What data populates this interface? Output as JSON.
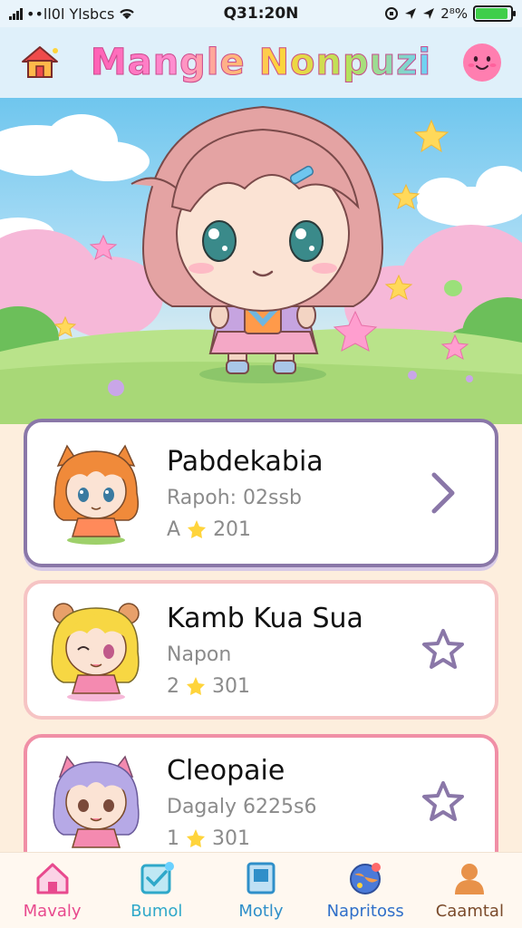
{
  "status_bar": {
    "carrier": "••ll0l Ylsbcs",
    "time": "Q31:20N",
    "battery_text": "2⁸%",
    "battery_level": 0.92,
    "battery_color": "#3fce4a"
  },
  "header": {
    "title": "Mangle Nonpuzi",
    "home_icon": "home-icon",
    "profile_icon": "smiley-face-icon"
  },
  "hero": {
    "scene": "chibi-character-in-meadow"
  },
  "list": [
    {
      "name": "Pabdekabia",
      "subtitle": "Rapoh: 02ssb",
      "rating_prefix": "A",
      "rating": "201",
      "action_icon": "chevron-right-icon",
      "hair_color": "#f08a3a"
    },
    {
      "name": "Kamb Kua Sua",
      "subtitle": "Napon",
      "rating_prefix": "2",
      "rating": "301",
      "action_icon": "star-outline-icon",
      "hair_color": "#f7d743"
    },
    {
      "name": "Cleopaie",
      "subtitle": "Dagaly 6225s6",
      "rating_prefix": "1",
      "rating": "301",
      "action_icon": "star-outline-icon",
      "hair_color": "#b6a9e6"
    }
  ],
  "bottom_nav": [
    {
      "label": "Mavaly",
      "icon": "home-icon",
      "color": "#e84a8e"
    },
    {
      "label": "Bumol",
      "icon": "checklist-icon",
      "color": "#2fa8c9"
    },
    {
      "label": "Motly",
      "icon": "book-icon",
      "color": "#2f8fc9"
    },
    {
      "label": "Napritoss",
      "icon": "globe-icon",
      "color": "#2f6fc9"
    },
    {
      "label": "Caamtal",
      "icon": "profile-icon",
      "color": "#7a4a2a"
    }
  ],
  "colors": {
    "accent_pink": "#ff5fb4",
    "card_border_active": "#8a77a8"
  }
}
